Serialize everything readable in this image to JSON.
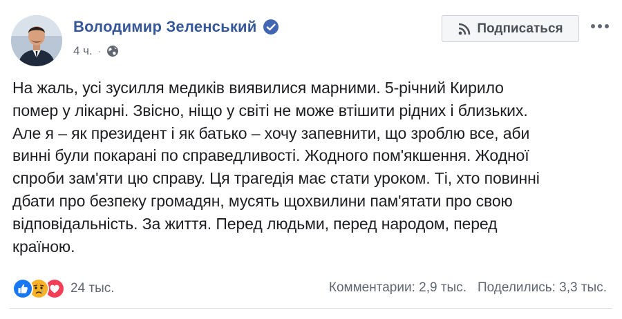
{
  "author": {
    "name": "Володимир Зеленський",
    "verified_icon": "verified-badge-icon",
    "timestamp": "4 ч.",
    "separator": "·",
    "privacy_icon": "globe-icon"
  },
  "actions": {
    "subscribe_label": "Подписаться",
    "subscribe_icon": "rss-icon",
    "more_icon": "more-options-icon"
  },
  "post": {
    "lines": [
      "На жаль, усі зусилля медиків виявилися марними. 5-річний Кирило",
      "помер у лікарні. Звісно, ніщо у світі не може втішити рідних і близьких.",
      "Але я – як президент і як батько – хочу запевнити, що зроблю все, аби",
      "винні були покарані по справедливості. Жодного пом'якшення. Жодної",
      "спроби зам'яти цю справу. Ця трагедія має стати уроком. Ті, хто повинні",
      "дбати про безпеку громадян, мусять щохвилини пам'ятати про свою",
      "відповідальність. За життя. Перед людьми, перед народом, перед",
      "країною."
    ]
  },
  "footer": {
    "reactions": [
      "like-icon",
      "sad-icon",
      "love-icon"
    ],
    "reaction_count": "24 тыс.",
    "comments": "Комментарии: 2,9 тыс.",
    "shares": "Поделились: 3,3 тыс."
  },
  "colors": {
    "name_link": "#365899",
    "meta_text": "#616770",
    "like": "#1877f2",
    "sad": "#f7b125",
    "love": "#f33e58"
  }
}
